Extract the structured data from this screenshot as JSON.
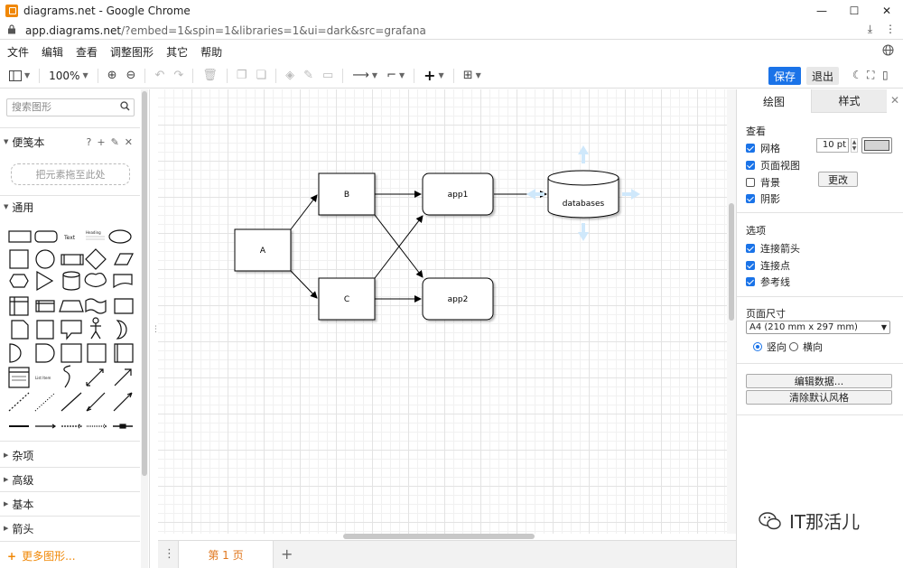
{
  "window": {
    "title": "diagrams.net - Google Chrome"
  },
  "address": {
    "domain": "app.diagrams.net",
    "rest": "/?embed=1&spin=1&libraries=1&ui=dark&src=grafana"
  },
  "menu": [
    "文件",
    "编辑",
    "查看",
    "调整图形",
    "其它",
    "帮助"
  ],
  "toolbar": {
    "zoom": "100%",
    "save": "保存",
    "exit": "退出"
  },
  "sidebar": {
    "search_placeholder": "搜索图形",
    "scratchpad": "便笺本",
    "scratchpad_help": "?",
    "drop_zone": "把元素拖至此处",
    "general": "通用",
    "misc": "杂项",
    "advanced": "高级",
    "basic": "基本",
    "arrows": "箭头",
    "more_shapes": "更多图形..."
  },
  "palette": {
    "text_label": "Text",
    "heading_label": "Heading",
    "list_label": "List Item"
  },
  "diagram": {
    "nodes": {
      "a": "A",
      "b": "B",
      "c": "C",
      "app1": "app1",
      "app2": "app2",
      "db": "databases"
    }
  },
  "pages": {
    "current": "第 1 页"
  },
  "format_panel": {
    "tab_diagram": "绘图",
    "tab_style": "样式",
    "view_title": "查看",
    "grid": "网格",
    "grid_size": "10 pt",
    "page_view": "页面视图",
    "background": "背景",
    "change": "更改",
    "shadow": "阴影",
    "options_title": "选项",
    "connection_arrows": "连接箭头",
    "connection_points": "连接点",
    "guides": "参考线",
    "page_size_title": "页面尺寸",
    "page_size": "A4 (210 mm x 297 mm)",
    "portrait": "竖向",
    "landscape": "横向",
    "edit_data": "编辑数据...",
    "clear_style": "清除默认风格"
  },
  "watermark": "IT那活儿",
  "colors": {
    "accent": "#1a73e8",
    "brand": "#f08705",
    "page_tab": "#e0761c"
  }
}
